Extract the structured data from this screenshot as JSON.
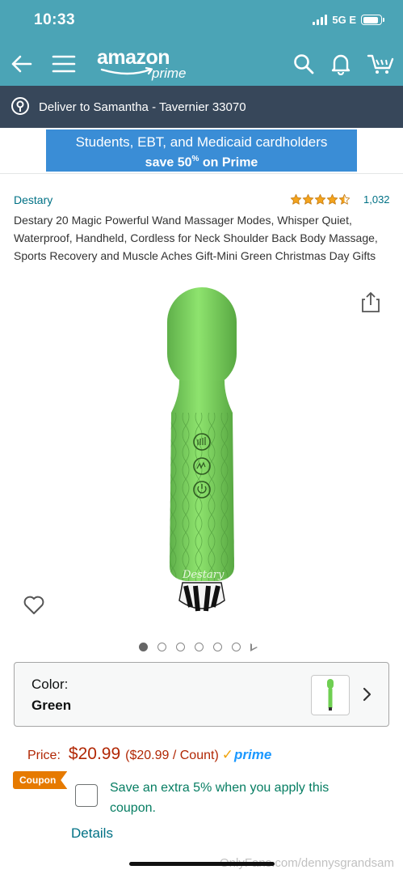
{
  "status_bar": {
    "time": "10:33",
    "network": "5G E"
  },
  "header": {
    "logo_text": "amazon",
    "logo_sub": "prime",
    "icons": [
      "back-arrow-icon",
      "menu-icon",
      "search-icon",
      "bell-icon",
      "cart-icon"
    ],
    "accent_color": "#4ba4b6"
  },
  "delivery": {
    "text": "Deliver to Samantha - Tavernier 33070"
  },
  "banner": {
    "line1": "Students, EBT, and Medicaid cardholders",
    "line2_prefix": "save 50",
    "line2_sup": "%",
    "line2_suffix": " on Prime"
  },
  "product": {
    "brand": "Destary",
    "rating_stars": 4.5,
    "review_count": "1,032",
    "title": "Destary 20 Magic Powerful Wand Massager Modes, Whisper Quiet, Waterproof, Handheld, Cordless for Neck Shoulder Back Body Massage, Sports Recovery and Muscle Aches Gift-Mini Green Christmas Day Gifts",
    "image_brand_mark": "Destary",
    "image_count": 6,
    "active_image": 1
  },
  "color_selector": {
    "label": "Color:",
    "value": "Green"
  },
  "price": {
    "label": "Price:",
    "value": "$20.99",
    "unit_price": "($20.99 / Count)",
    "prime_label": "prime"
  },
  "coupon": {
    "tag": "Coupon",
    "text": "Save an extra 5% when you apply this coupon.",
    "details": "Details"
  },
  "watermark": "OnlyFans.com/dennysgrandsam"
}
